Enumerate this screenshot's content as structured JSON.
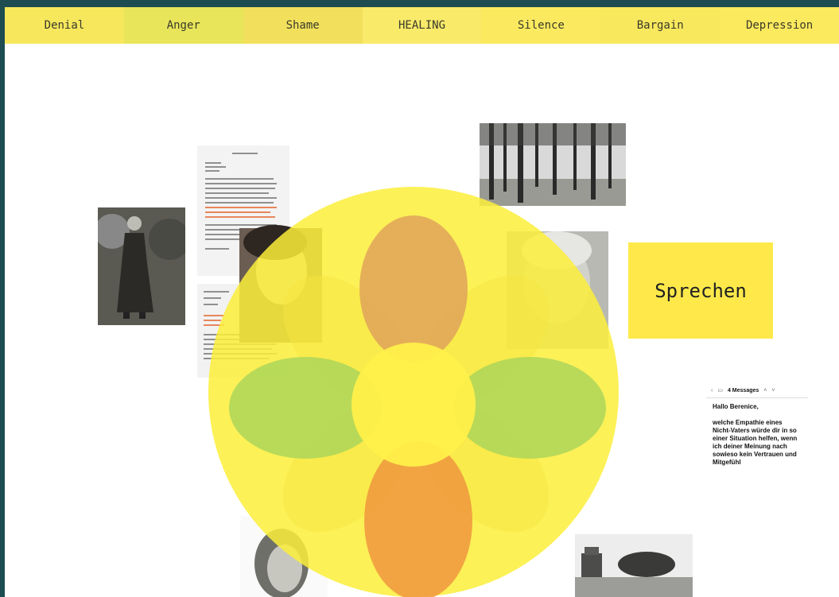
{
  "nav": {
    "tabs": [
      {
        "label": "Denial",
        "color": "#f7e75c"
      },
      {
        "label": "Anger",
        "color": "#e8e55a"
      },
      {
        "label": "Shame",
        "color": "#f2e05c"
      },
      {
        "label": "HEALING",
        "color": "#f9ea6a"
      },
      {
        "label": "Silence",
        "color": "#fbea5f"
      },
      {
        "label": "Bargain",
        "color": "#f8e85d"
      },
      {
        "label": "Depression",
        "color": "#fbe95e"
      }
    ]
  },
  "card": {
    "label": "Sprechen"
  },
  "email": {
    "count": "4 Messages",
    "greeting": "Hallo Berenice,",
    "body": "welche Empathie eines Nicht-Vaters würde dir in so einer Situation helfen, wenn ich deiner Meinung nach sowieso kein Vertrauen und Mitgefühl",
    "icons": [
      "chevron-left-icon",
      "tray-icon",
      "chevron-up-icon",
      "chevron-down-icon"
    ]
  },
  "flower": {
    "circle_color": "#fbef3a",
    "top_petal_color": "#e0a35a",
    "bottom_petal_color": "#f0963e",
    "side_petal_color": "#a8d45a",
    "center_color": "#fff04a"
  }
}
